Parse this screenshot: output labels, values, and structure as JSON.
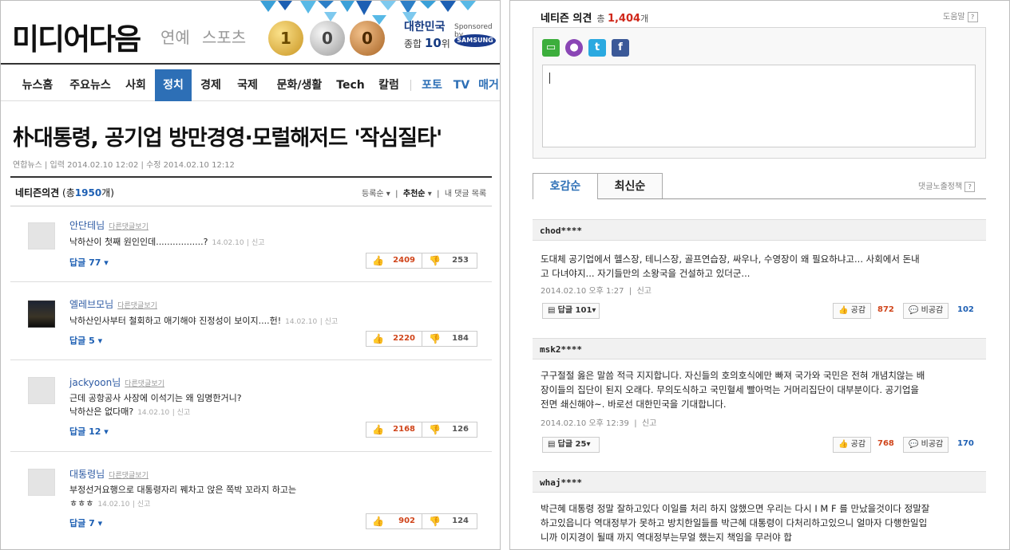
{
  "left": {
    "logo": "미디어다음",
    "subnav": [
      "연예",
      "스포츠"
    ],
    "medals": {
      "gold": "1",
      "silver": "0",
      "bronze": "0"
    },
    "team": {
      "name": "대한민국",
      "rank_prefix": "종합",
      "rank_num": "10",
      "rank_suffix": "위"
    },
    "sponsor_label": "Sponsored by",
    "sponsor_name": "SAMSUNG",
    "menu": [
      "뉴스홈",
      "주요뉴스",
      "사회",
      "정치",
      "경제",
      "국제",
      "문화/생활",
      "Tech",
      "칼럼",
      "포토",
      "TV",
      "매거"
    ],
    "article": {
      "title": "朴대통령, 공기업 방만경영·모럴해저드 '작심질타'",
      "meta": "연합뉴스 | 입력 2014.02.10 12:02 | 수정 2014.02.10 12:12"
    },
    "comments_header": {
      "label": "네티즌의견",
      "open": "(총",
      "count": "1950",
      "close": "개)"
    },
    "sort": {
      "by_date": "등록순",
      "by_reco": "추천순",
      "mine": "내 댓글 목록"
    },
    "more_label": "다른댓글보기",
    "report_label": "신고",
    "comments": [
      {
        "user": "안단테님",
        "text1": "낙하산이 첫째 원인인데.................?",
        "text2": "",
        "date": "14.02.10",
        "reply": "답글 77",
        "up": "2409",
        "down": "253"
      },
      {
        "user": "엘레브모님",
        "text1": "낙하산인사부터 철회하고 애기해야 진정성이 보이지....헌!",
        "text2": "",
        "date": "14.02.10",
        "reply": "답글 5",
        "up": "2220",
        "down": "184"
      },
      {
        "user": "jackyoon님",
        "text1": "근데 공항공사 사장에 이석기는 왜 임명한거니?",
        "text2": "낙하산은 없다매?",
        "date": "14.02.10",
        "reply": "답글 12",
        "up": "2168",
        "down": "126"
      },
      {
        "user": "대통령님",
        "text1": "부정선거요행으로 대통령자리 꿰차고 앉은 쪽박 꼬라지 하고는",
        "text2": "ㅎㅎㅎ",
        "date": "14.02.10",
        "reply": "답글 7",
        "up": "902",
        "down": "124"
      }
    ]
  },
  "right": {
    "title": "네티즌 의견",
    "total_prefix": "총",
    "total_count": "1,404",
    "total_suffix": "개",
    "help": "도움말",
    "help_icon": "?",
    "share_icons": [
      "yozm-icon",
      "mypeople-icon",
      "twitter-icon",
      "facebook-icon"
    ],
    "tabs": [
      "호감순",
      "최신순"
    ],
    "policy": "댓글노출정책",
    "report_label": "신고",
    "up_label": "공감",
    "down_label": "비공감",
    "comments": [
      {
        "user": "chod****",
        "line1": "도대체 공기업에서 헬스장, 테니스장, 골프연습장, 싸우나, 수영장이 왜 필요하냐고... 사회에서 돈내",
        "line2": "고 다녀야지... 자기들만의 소왕국을 건설하고 있더군...",
        "line3": "",
        "date": "2014.02.10 오후 1:27",
        "reply": "답글 101",
        "up": "872",
        "down": "102"
      },
      {
        "user": "msk2****",
        "line1": "구구절절 옳은 말씀 적극 지지합니다. 자신들의 호의호식에만 빠져 국가와 국민은 전혀 개념치않는 배",
        "line2": "장이들의 집단이 된지 오래다. 무의도식하고 국민혈세 빨아먹는 거머리집단이 대부분이다. 공기업을",
        "line3": "전면 쇄신해야~. 바로선 대한민국을 기대합니다.",
        "date": "2014.02.10 오후 12:39",
        "reply": "답글 25",
        "up": "768",
        "down": "170"
      },
      {
        "user": "whaj****",
        "line1": "박근혜 대통령 정말 잘하고있다 이일를 처리 하지 않했으면 우리는 다시 I M F 를 만났을것이다 정말잘",
        "line2": "하고있읍니다 역대정부가 못하고 방치한일들를 박근혜 대통령이 다처리하고있으니 얼마자 다행한일입",
        "line3": "니까 이지경이 될때 까지 역대정부는무얼 했는지 책임을 무러야 합"
      }
    ]
  }
}
